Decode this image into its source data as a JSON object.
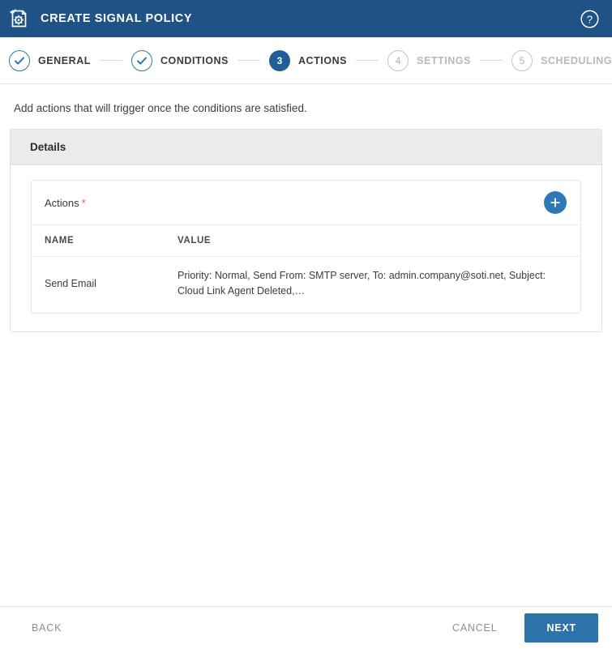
{
  "window": {
    "title": "CREATE SIGNAL POLICY",
    "icon": "signal-policy-document-icon",
    "help_icon": "help-circle-icon",
    "header_color": "#1f5285"
  },
  "stepper": {
    "steps": [
      {
        "number": "1",
        "label": "GENERAL",
        "state": "done"
      },
      {
        "number": "2",
        "label": "CONDITIONS",
        "state": "done"
      },
      {
        "number": "3",
        "label": "ACTIONS",
        "state": "active"
      },
      {
        "number": "4",
        "label": "SETTINGS",
        "state": "todo"
      },
      {
        "number": "5",
        "label": "SCHEDULING",
        "state": "todo"
      }
    ],
    "active_color": "#1f5f97",
    "done_color": "#2e76ad",
    "todo_color": "#b8b8b8"
  },
  "main": {
    "instruction": "Add actions that will trigger once the conditions are satisfied.",
    "panel": {
      "title": "Details",
      "actions_card": {
        "label": "Actions",
        "required_marker": "*",
        "required_color": "#e2574c",
        "add_button_icon": "plus-icon",
        "add_button_color": "#2e79b5",
        "columns": [
          "NAME",
          "VALUE"
        ],
        "rows": [
          {
            "name": "Send Email",
            "value": "Priority: Normal, Send From: SMTP server, To: admin.company@soti.net, Subject: Cloud Link Agent Deleted,…"
          }
        ]
      }
    }
  },
  "footer": {
    "back_label": "BACK",
    "cancel_label": "CANCEL",
    "next_label": "NEXT",
    "next_color": "#2d72a8"
  }
}
